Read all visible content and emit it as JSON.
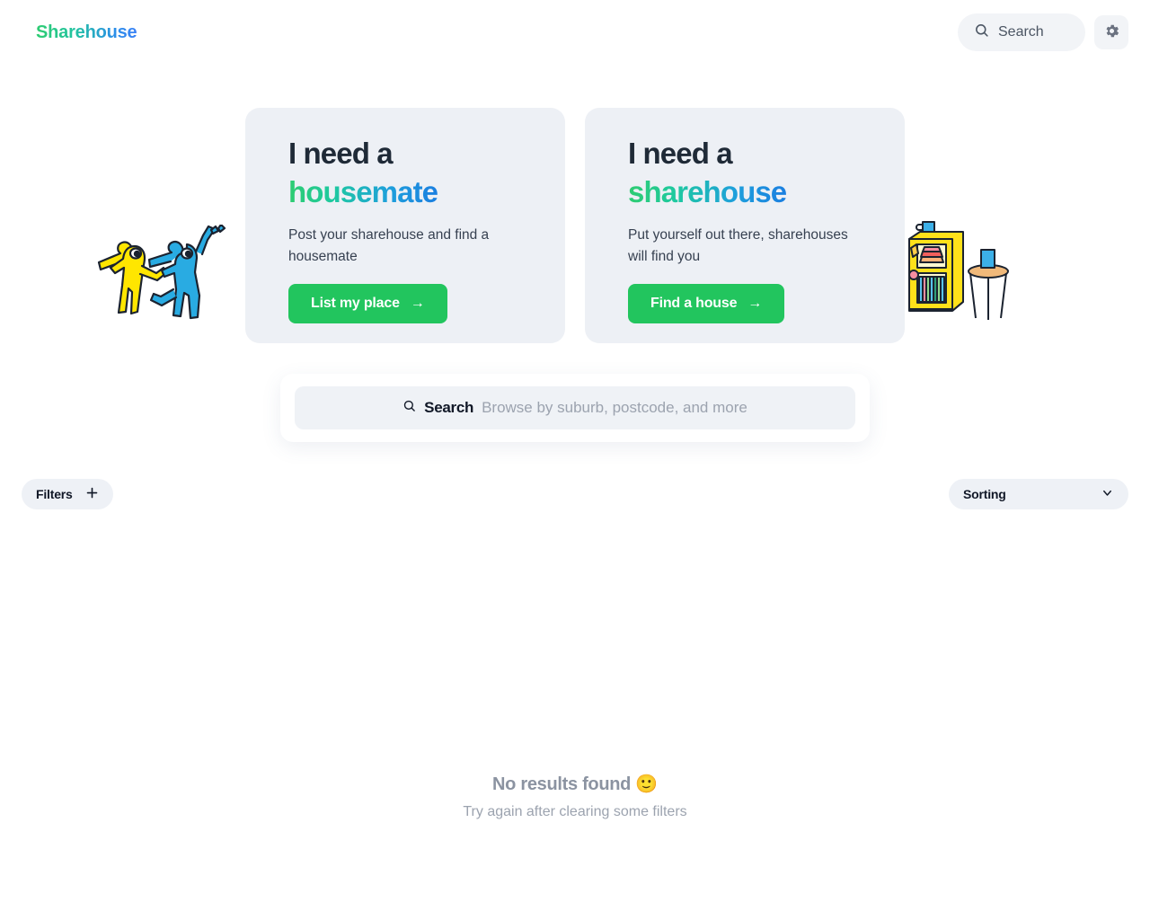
{
  "header": {
    "brand": "Sharehouse",
    "search_label": "Search",
    "search_icon": "search-icon",
    "settings_icon": "gear-icon"
  },
  "hero": {
    "cards": [
      {
        "title_line1": "I need a",
        "title_line2": "housemate",
        "description": "Post your sharehouse and find a housemate",
        "cta_label": "List my place",
        "cta_arrow": "→"
      },
      {
        "title_line1": "I need a",
        "title_line2": "sharehouse",
        "description": "Put yourself out there, sharehouses will find you",
        "cta_label": "Find a house",
        "cta_arrow": "→"
      }
    ],
    "illustration_left": "two-people-waving-illustration",
    "illustration_right": "bookshelf-and-stool-illustration"
  },
  "search": {
    "icon": "search-icon",
    "label": "Search",
    "placeholder": "Browse by suburb, postcode, and more"
  },
  "controls": {
    "filters_label": "Filters",
    "filters_icon": "plus-icon",
    "sorting_label": "Sorting",
    "sorting_icon": "chevron-down-icon"
  },
  "empty_state": {
    "title": "No results found 🙂",
    "subtitle": "Try again after clearing some filters"
  },
  "colors": {
    "accent_green": "#22c55e",
    "gradient_start": "#2ecc71",
    "gradient_end": "#3b82f6",
    "card_bg": "#edf0f5",
    "chip_bg": "#eef1f6",
    "muted_text": "#9ca3af"
  }
}
